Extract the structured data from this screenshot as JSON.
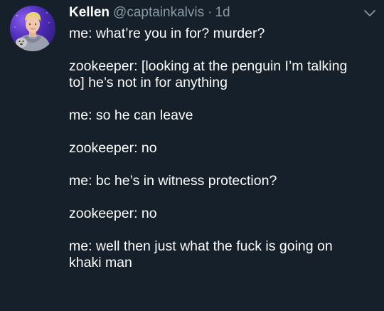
{
  "tweet": {
    "author": {
      "display_name": "Kellen",
      "handle": "@captainkalvis",
      "separator": "·",
      "timestamp": "1d",
      "avatar_icon": "profile-photo"
    },
    "menu_icon": "chevron-down-icon",
    "lines": [
      "me: what’re you in for? murder?",
      "",
      "zookeeper: [looking at the penguin I’m talking",
      "to] he’s not in for anything",
      "",
      "me: so he can leave",
      "",
      "zookeeper: no",
      "",
      "me: bc he’s in witness protection?",
      "",
      "zookeeper: no",
      "",
      "me: well then just what the fuck is going on",
      "khaki man"
    ]
  },
  "colors": {
    "background": "#15202b",
    "text_primary": "#ffffff",
    "text_secondary": "#8899a6"
  }
}
